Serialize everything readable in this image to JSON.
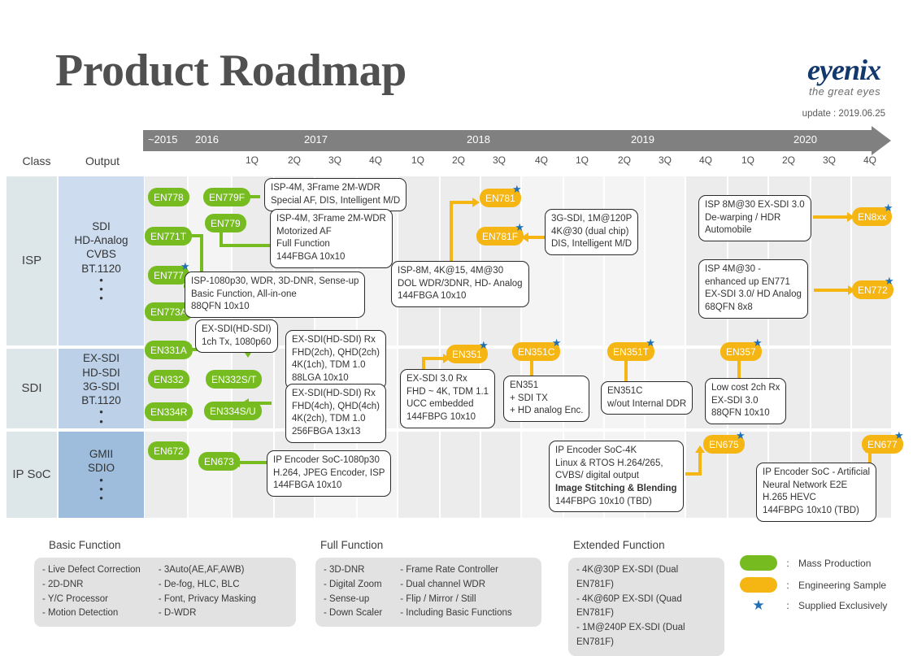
{
  "header": {
    "title": "Product Roadmap",
    "logo_main": "eyenix",
    "logo_tagline": "the great eyes",
    "update": "update : 2019.06.25"
  },
  "timeline": {
    "years": [
      "~2015",
      "2016",
      "2017",
      "2018",
      "2019",
      "2020"
    ],
    "quarters": [
      "1Q",
      "2Q",
      "3Q",
      "4Q",
      "1Q",
      "2Q",
      "3Q",
      "4Q",
      "1Q",
      "2Q",
      "3Q",
      "4Q",
      "1Q",
      "2Q",
      "3Q",
      "4Q"
    ]
  },
  "columns": {
    "class": "Class",
    "output": "Output"
  },
  "rows": [
    {
      "class": "ISP",
      "output": [
        "SDI",
        "HD-Analog",
        "CVBS",
        "BT.1120"
      ]
    },
    {
      "class": "SDI",
      "output": [
        "EX-SDI",
        "HD-SDI",
        "3G-SDI",
        "BT.1120"
      ]
    },
    {
      "class": "IP SoC",
      "output": [
        "GMII",
        "SDIO"
      ]
    }
  ],
  "badges": [
    {
      "id": "b-en778",
      "label": "EN778",
      "color": "green",
      "star": false
    },
    {
      "id": "b-en779f",
      "label": "EN779F",
      "color": "green",
      "star": false
    },
    {
      "id": "b-en779",
      "label": "EN779",
      "color": "green",
      "star": false
    },
    {
      "id": "b-en771t",
      "label": "EN771T",
      "color": "green",
      "star": false
    },
    {
      "id": "b-en777",
      "label": "EN777",
      "color": "green",
      "star": true
    },
    {
      "id": "b-en773a",
      "label": "EN773A",
      "color": "green",
      "star": true
    },
    {
      "id": "b-en781",
      "label": "EN781",
      "color": "amber",
      "star": true
    },
    {
      "id": "b-en781f",
      "label": "EN781F",
      "color": "amber",
      "star": true
    },
    {
      "id": "b-en8xx",
      "label": "EN8xx",
      "color": "amber",
      "star": true
    },
    {
      "id": "b-en772",
      "label": "EN772",
      "color": "amber",
      "star": true
    },
    {
      "id": "b-en331a",
      "label": "EN331A",
      "color": "green",
      "star": false
    },
    {
      "id": "b-en332",
      "label": "EN332",
      "color": "green",
      "star": false
    },
    {
      "id": "b-en334r",
      "label": "EN334R",
      "color": "green",
      "star": false
    },
    {
      "id": "b-en332st",
      "label": "EN332S/T",
      "color": "green",
      "star": false
    },
    {
      "id": "b-en334su",
      "label": "EN334S/U",
      "color": "green",
      "star": false
    },
    {
      "id": "b-en351",
      "label": "EN351",
      "color": "amber",
      "star": true
    },
    {
      "id": "b-en351c",
      "label": "EN351C",
      "color": "amber",
      "star": true
    },
    {
      "id": "b-en351t",
      "label": "EN351T",
      "color": "amber",
      "star": true
    },
    {
      "id": "b-en357",
      "label": "EN357",
      "color": "amber",
      "star": true
    },
    {
      "id": "b-en672",
      "label": "EN672",
      "color": "green",
      "star": false
    },
    {
      "id": "b-en673",
      "label": "EN673",
      "color": "green",
      "star": false
    },
    {
      "id": "b-en675",
      "label": "EN675",
      "color": "amber",
      "star": true
    },
    {
      "id": "b-en677",
      "label": "EN677",
      "color": "amber",
      "star": true
    }
  ],
  "notes": {
    "n1": [
      "ISP-4M, 3Frame 2M-WDR",
      "Special AF, DIS, Intelligent M/D"
    ],
    "n2": [
      "ISP-4M, 3Frame 2M-WDR",
      "Motorized AF",
      "Full Function",
      "144FBGA 10x10"
    ],
    "n3": [
      "ISP-1080p30, WDR, 3D-DNR, Sense-up",
      "Basic Function, All-in-one",
      "88QFN 10x10"
    ],
    "n4": [
      "ISP-8M,  4K@15, 4M@30",
      "DOL WDR/3DNR, HD- Analog",
      "144FBGA 10x10"
    ],
    "n5": [
      "3G-SDI, 1M@120P",
      "4K@30 (dual chip)",
      "DIS,  Intelligent M/D"
    ],
    "n6": [
      "ISP 8M@30  EX-SDI 3.0",
      "De-warping / HDR",
      "Automobile"
    ],
    "n7": [
      "ISP 4M@30  -",
      "enhanced up EN771",
      "EX-SDI 3.0/  HD Analog",
      "68QFN 8x8"
    ],
    "n8": [
      "EX-SDI(HD-SDI)",
      "1ch Tx, 1080p60"
    ],
    "n9": [
      "EX-SDI(HD-SDI) Rx",
      "FHD(2ch), QHD(2ch)",
      "4K(1ch), TDM 1.0",
      "88LGA 10x10"
    ],
    "n10": [
      "EX-SDI(HD-SDI) Rx",
      "FHD(4ch), QHD(4ch)",
      "4K(2ch), TDM 1.0",
      "256FBGA 13x13"
    ],
    "n11": [
      "EX-SDI 3.0 Rx",
      "FHD ~ 4K, TDM 1.1",
      "UCC embedded",
      "144FBPG 10x10"
    ],
    "n12": [
      "EN351",
      "+ SDI TX",
      "+ HD analog Enc."
    ],
    "n13": [
      "EN351C",
      "w/out  Internal DDR"
    ],
    "n14": [
      "Low cost 2ch Rx",
      "EX-SDI 3.0",
      "88QFN 10x10"
    ],
    "n15": [
      "IP Encoder SoC-1080p30",
      "H.264, JPEG Encoder, ISP",
      "144FBGA 10x10"
    ],
    "n16": [
      "IP Encoder SoC-4K",
      "Linux & RTOS  H.264/265,",
      "CVBS/ digital output",
      "Image Stitching  &  Blending",
      "144FBPG 10x10 (TBD)"
    ],
    "n16_bold_index": 3,
    "n17": [
      "IP Encoder SoC - Artificial",
      "Neural Network E2E",
      "H.265 HEVC",
      "144FBPG 10x10 (TBD)"
    ]
  },
  "legend": {
    "basic": {
      "title": "Basic Function",
      "col1": [
        "-  Live Defect  Correction",
        "-  2D-DNR",
        "-  Y/C Processor",
        "-  Motion Detection"
      ],
      "col2": [
        "-  3Auto(AE,AF,AWB)",
        "-  De-fog, HLC,  BLC",
        "-  Font, Privacy Masking",
        "-  D-WDR"
      ]
    },
    "full": {
      "title": "Full Function",
      "col1": [
        "-  3D-DNR",
        "-  Digital Zoom",
        "-  Sense-up",
        "-  Down Scaler"
      ],
      "col2": [
        "-  Frame Rate Controller",
        "-  Dual channel  WDR",
        "-  Flip / Mirror / Still",
        "-  Including Basic Functions"
      ]
    },
    "extended": {
      "title": "Extended Function",
      "col1": [
        "-  4K@30P EX-SDI (Dual EN781F)",
        "-  4K@60P EX-SDI (Quad EN781F)",
        "-  1M@240P EX-SDI (Dual EN781F)"
      ]
    },
    "key": [
      {
        "icon": "pill",
        "color": "#76bc21",
        "label": "Mass Production"
      },
      {
        "icon": "pill",
        "color": "#f5b512",
        "label": "Engineering Sample"
      },
      {
        "icon": "star",
        "color": "#1f6fb4",
        "label": "Supplied Exclusively"
      }
    ],
    "colon": ":"
  },
  "colors": {
    "green": "#76bc21",
    "amber": "#f5b512",
    "star": "#1f6fb4",
    "timeline": "#808080",
    "class_cell": "#dde6e8",
    "out_isp": "#cddcef",
    "out_sdi": "#bcd1e8",
    "out_ipsoc": "#9ebcdc"
  }
}
